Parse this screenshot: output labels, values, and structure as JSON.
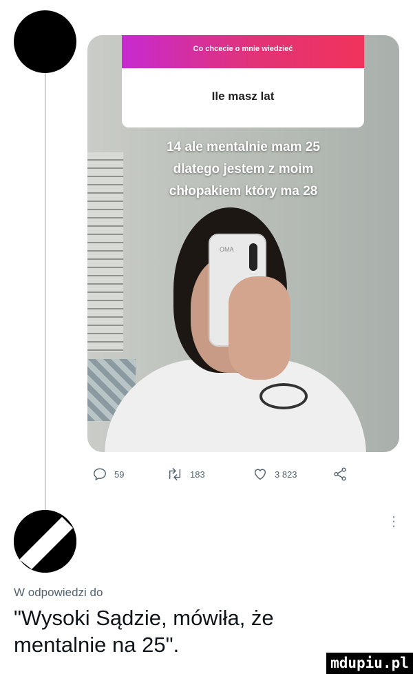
{
  "post": {
    "image": {
      "question_header": "Co chcecie o mnie wiedzieć",
      "question": "Ile masz lat",
      "answer_lines": [
        "14 ale mentalnie mam 25",
        "dlatego jestem z moim",
        "chłopakiem który ma 28"
      ],
      "phone_case_text": "OMA"
    },
    "actions": {
      "replies": "59",
      "retweets": "183",
      "likes": "3 823"
    }
  },
  "reply": {
    "replying_to": "W odpowiedzi do",
    "text": "\"Wysoki Sądzie, mówiła, że mentalnie na 25\"."
  },
  "watermark": "mdupiu.pl",
  "colors": {
    "question_gradient_start": "#c72ad0",
    "question_gradient_end": "#f0335b",
    "action_gray": "#536471",
    "thread_line": "#cfd3d7"
  },
  "icons": [
    "reply-icon",
    "retweet-icon",
    "like-icon",
    "share-icon",
    "more-icon"
  ]
}
